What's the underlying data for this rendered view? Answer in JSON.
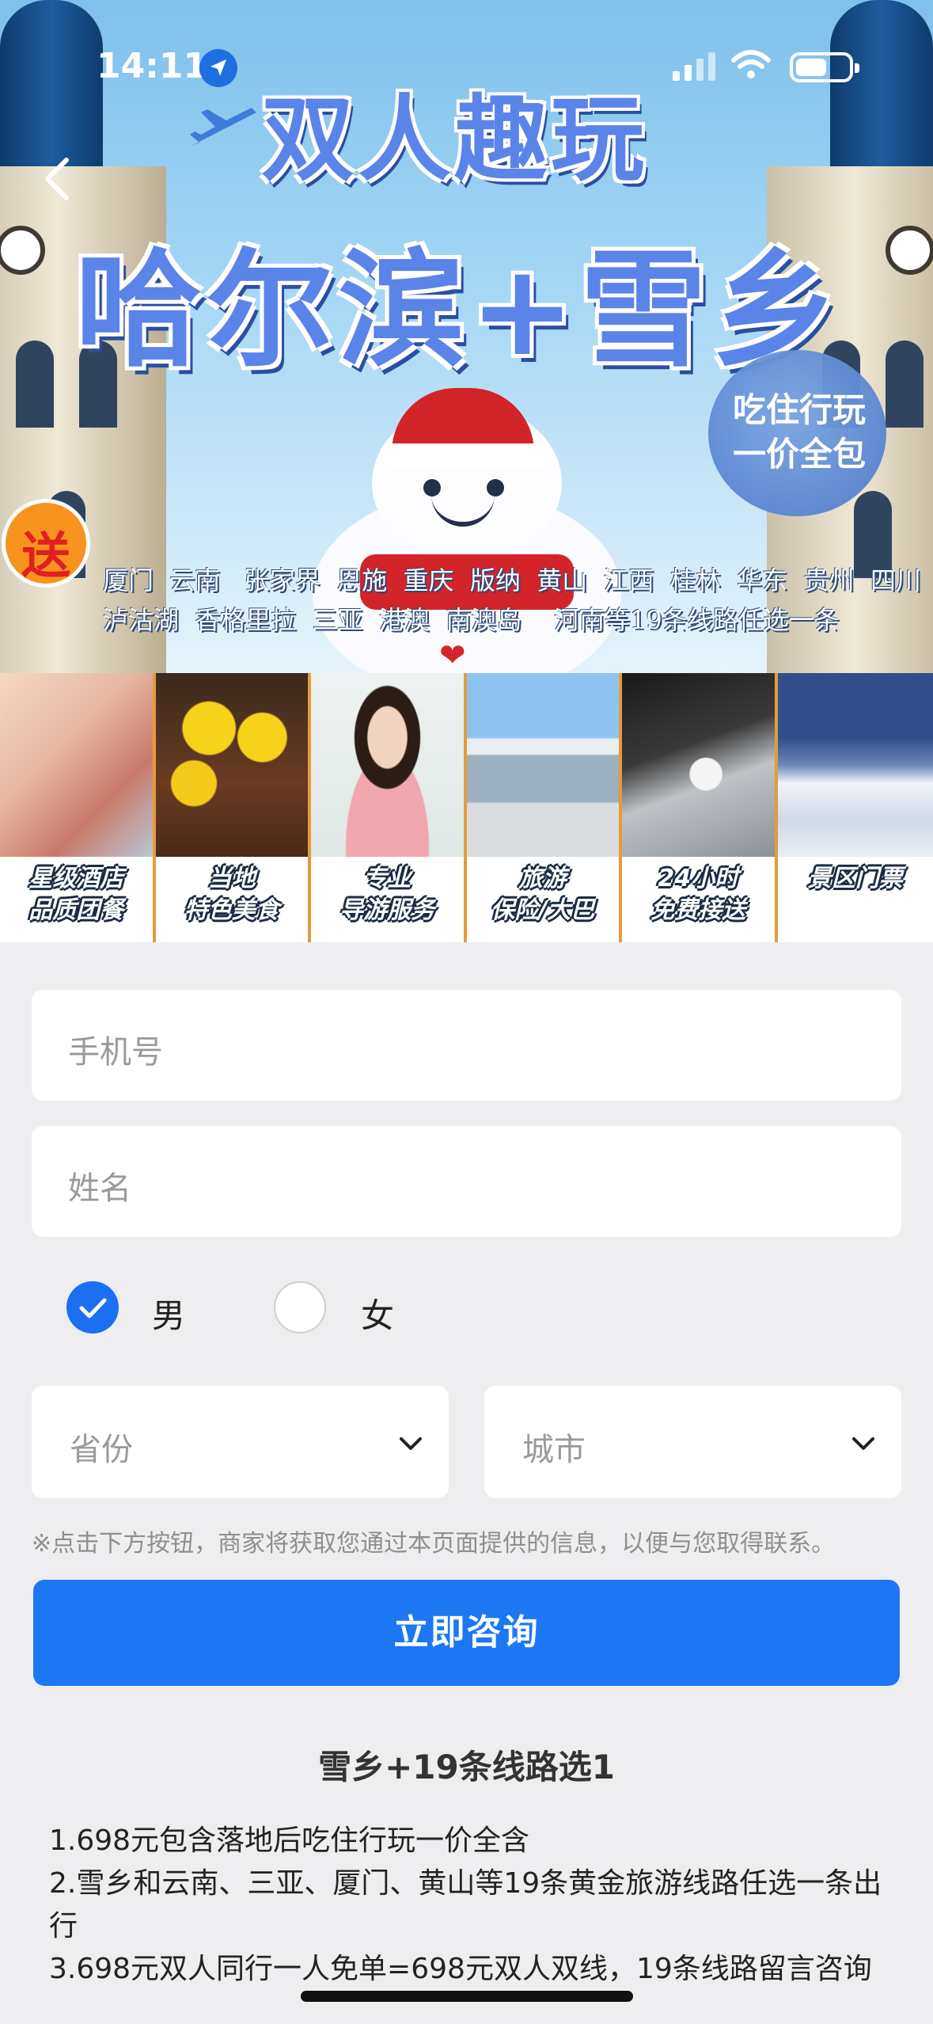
{
  "status_bar": {
    "time": "14:11"
  },
  "hero": {
    "headline": "双人趣玩",
    "headline2": "哈尔滨+雪乡",
    "badge_line1": "吃住行玩",
    "badge_line2": "一价全包",
    "gift": "送",
    "routes_line1": "厦门  云南   张家界  恩施  重庆  版纳  黄山  江西  桂林  华东  贵州  四川",
    "routes_line2": "泸沽湖  香格里拉  三亚  港澳  南澳岛    河南等19条线路任选一条"
  },
  "features": [
    {
      "line1": "星级酒店",
      "line2": "品质团餐"
    },
    {
      "line1": "当地",
      "line2": "特色美食"
    },
    {
      "line1": "专业",
      "line2": "导游服务"
    },
    {
      "line1": "旅游",
      "line2": "保险/大巴"
    },
    {
      "line1": "24小时",
      "line2": "免费接送"
    },
    {
      "line1": "景区门票",
      "line2": ""
    }
  ],
  "form": {
    "phone_placeholder": "手机号",
    "name_placeholder": "姓名",
    "gender_male": "男",
    "gender_female": "女",
    "gender_selected": "男",
    "province_placeholder": "省份",
    "city_placeholder": "城市",
    "notice": "※点击下方按钮，商家将获取您通过本页面提供的信息，以便与您取得联系。",
    "submit_label": "立即咨询"
  },
  "details": {
    "title": "雪乡+19条线路选1",
    "items": [
      "1.698元包含落地后吃住行玩一价全含",
      "2.雪乡和云南、三亚、厦门、黄山等19条黄金旅游线路任选一条出行",
      "3.698元双人同行一人免单=698元双人双线，19条线路留言咨询"
    ]
  },
  "colors": {
    "accent": "#1c78f2",
    "headline": "#5b84e8",
    "background": "#eeeef0"
  }
}
